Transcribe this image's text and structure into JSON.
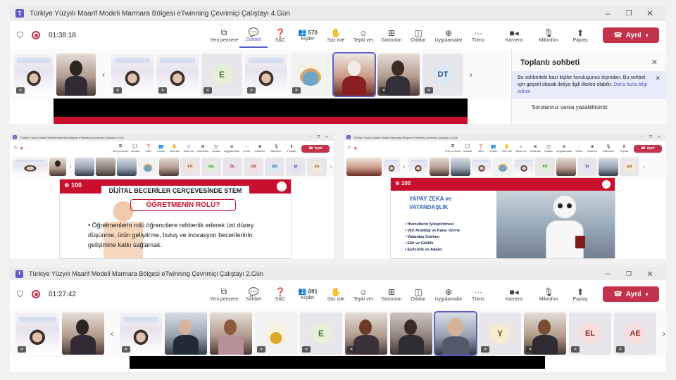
{
  "top_window": {
    "title": "Türkiye Yüzyılı Maarif Modeli Marmara Bölgesi eTwinning Çevrimiçi Çalıştayı 4.Gün",
    "timer": "01:38:18",
    "people_count": "570",
    "chat_title": "Toplantı sohbeti",
    "chat_notice": "Bu sohbetteki bazı kişiler kuruluşunuz dışından. Bu sohbet için geçerli olacak iletiye ilgili ilkeleri olabilir.",
    "chat_notice_link": "Daha fazla bilgi edinin",
    "chat_message": "Sorularınız varsa yazabilirsiniz",
    "avatars": [
      "E",
      "DT"
    ]
  },
  "toolbar": {
    "new_window": "Yeni pencere",
    "chat": "Sohbet",
    "qa": "S&C",
    "people": "Kişiler",
    "raise_hand": "Söz iste",
    "react": "Tepki ver",
    "view": "Görünüm",
    "rooms": "Odalar",
    "apps": "Uygulamalar",
    "more": "Tümü",
    "camera": "Kamera",
    "mic": "Mikrofon",
    "share": "Paylaş",
    "leave": "Ayrıl"
  },
  "mid_left": {
    "slide_title": "DİJİTAL BECERİLER ÇERÇEVESİNDE STEM",
    "slide_subtitle": "ÖĞRETMENİN ROLÜ?",
    "slide_body": "Öğretmenlerin rolü öğrencilere rehberlik ederek üst düzey düşünme, ürün geliştirme, buluş ve inovasyon becerilerinin gelişimine katkı sağlamak.",
    "avatars": [
      "FO",
      "GG",
      "ÖL",
      "CB",
      "DO",
      "EI",
      "SG"
    ]
  },
  "mid_right": {
    "slide_title_line1": "YAPAY ZEKA ve",
    "slide_title_line2": "VATANDAŞLIK",
    "bullets": [
      "Hizmetlerin İyileştirilmesi",
      "Veri Analitiği ve Karar Verme",
      "Vatandaş Katılımı",
      "Etik ve Gizlilik",
      "Eşitsizlik ve Adalet"
    ],
    "avatars": [
      "FÖ",
      "IU",
      "EA"
    ]
  },
  "bottom_window": {
    "title": "Türkiye Yüzyılı Maarif Modeli Marmara Bölgesi eTwinning Çevrimiçi Çalıştayı 2.Gün",
    "timer": "01:27:42",
    "people_count": "691",
    "avatars": [
      "E",
      "Y",
      "EL",
      "AE"
    ]
  },
  "icons": {
    "shield": "shield-icon",
    "record": "record-icon",
    "camera": "camera-icon",
    "mic_off": "mic-off-icon",
    "share": "share-icon",
    "phone": "phone-icon"
  },
  "colors": {
    "teams_purple": "#5b5fc7",
    "leave_red": "#c4314b",
    "slide_red": "#c8102e"
  }
}
